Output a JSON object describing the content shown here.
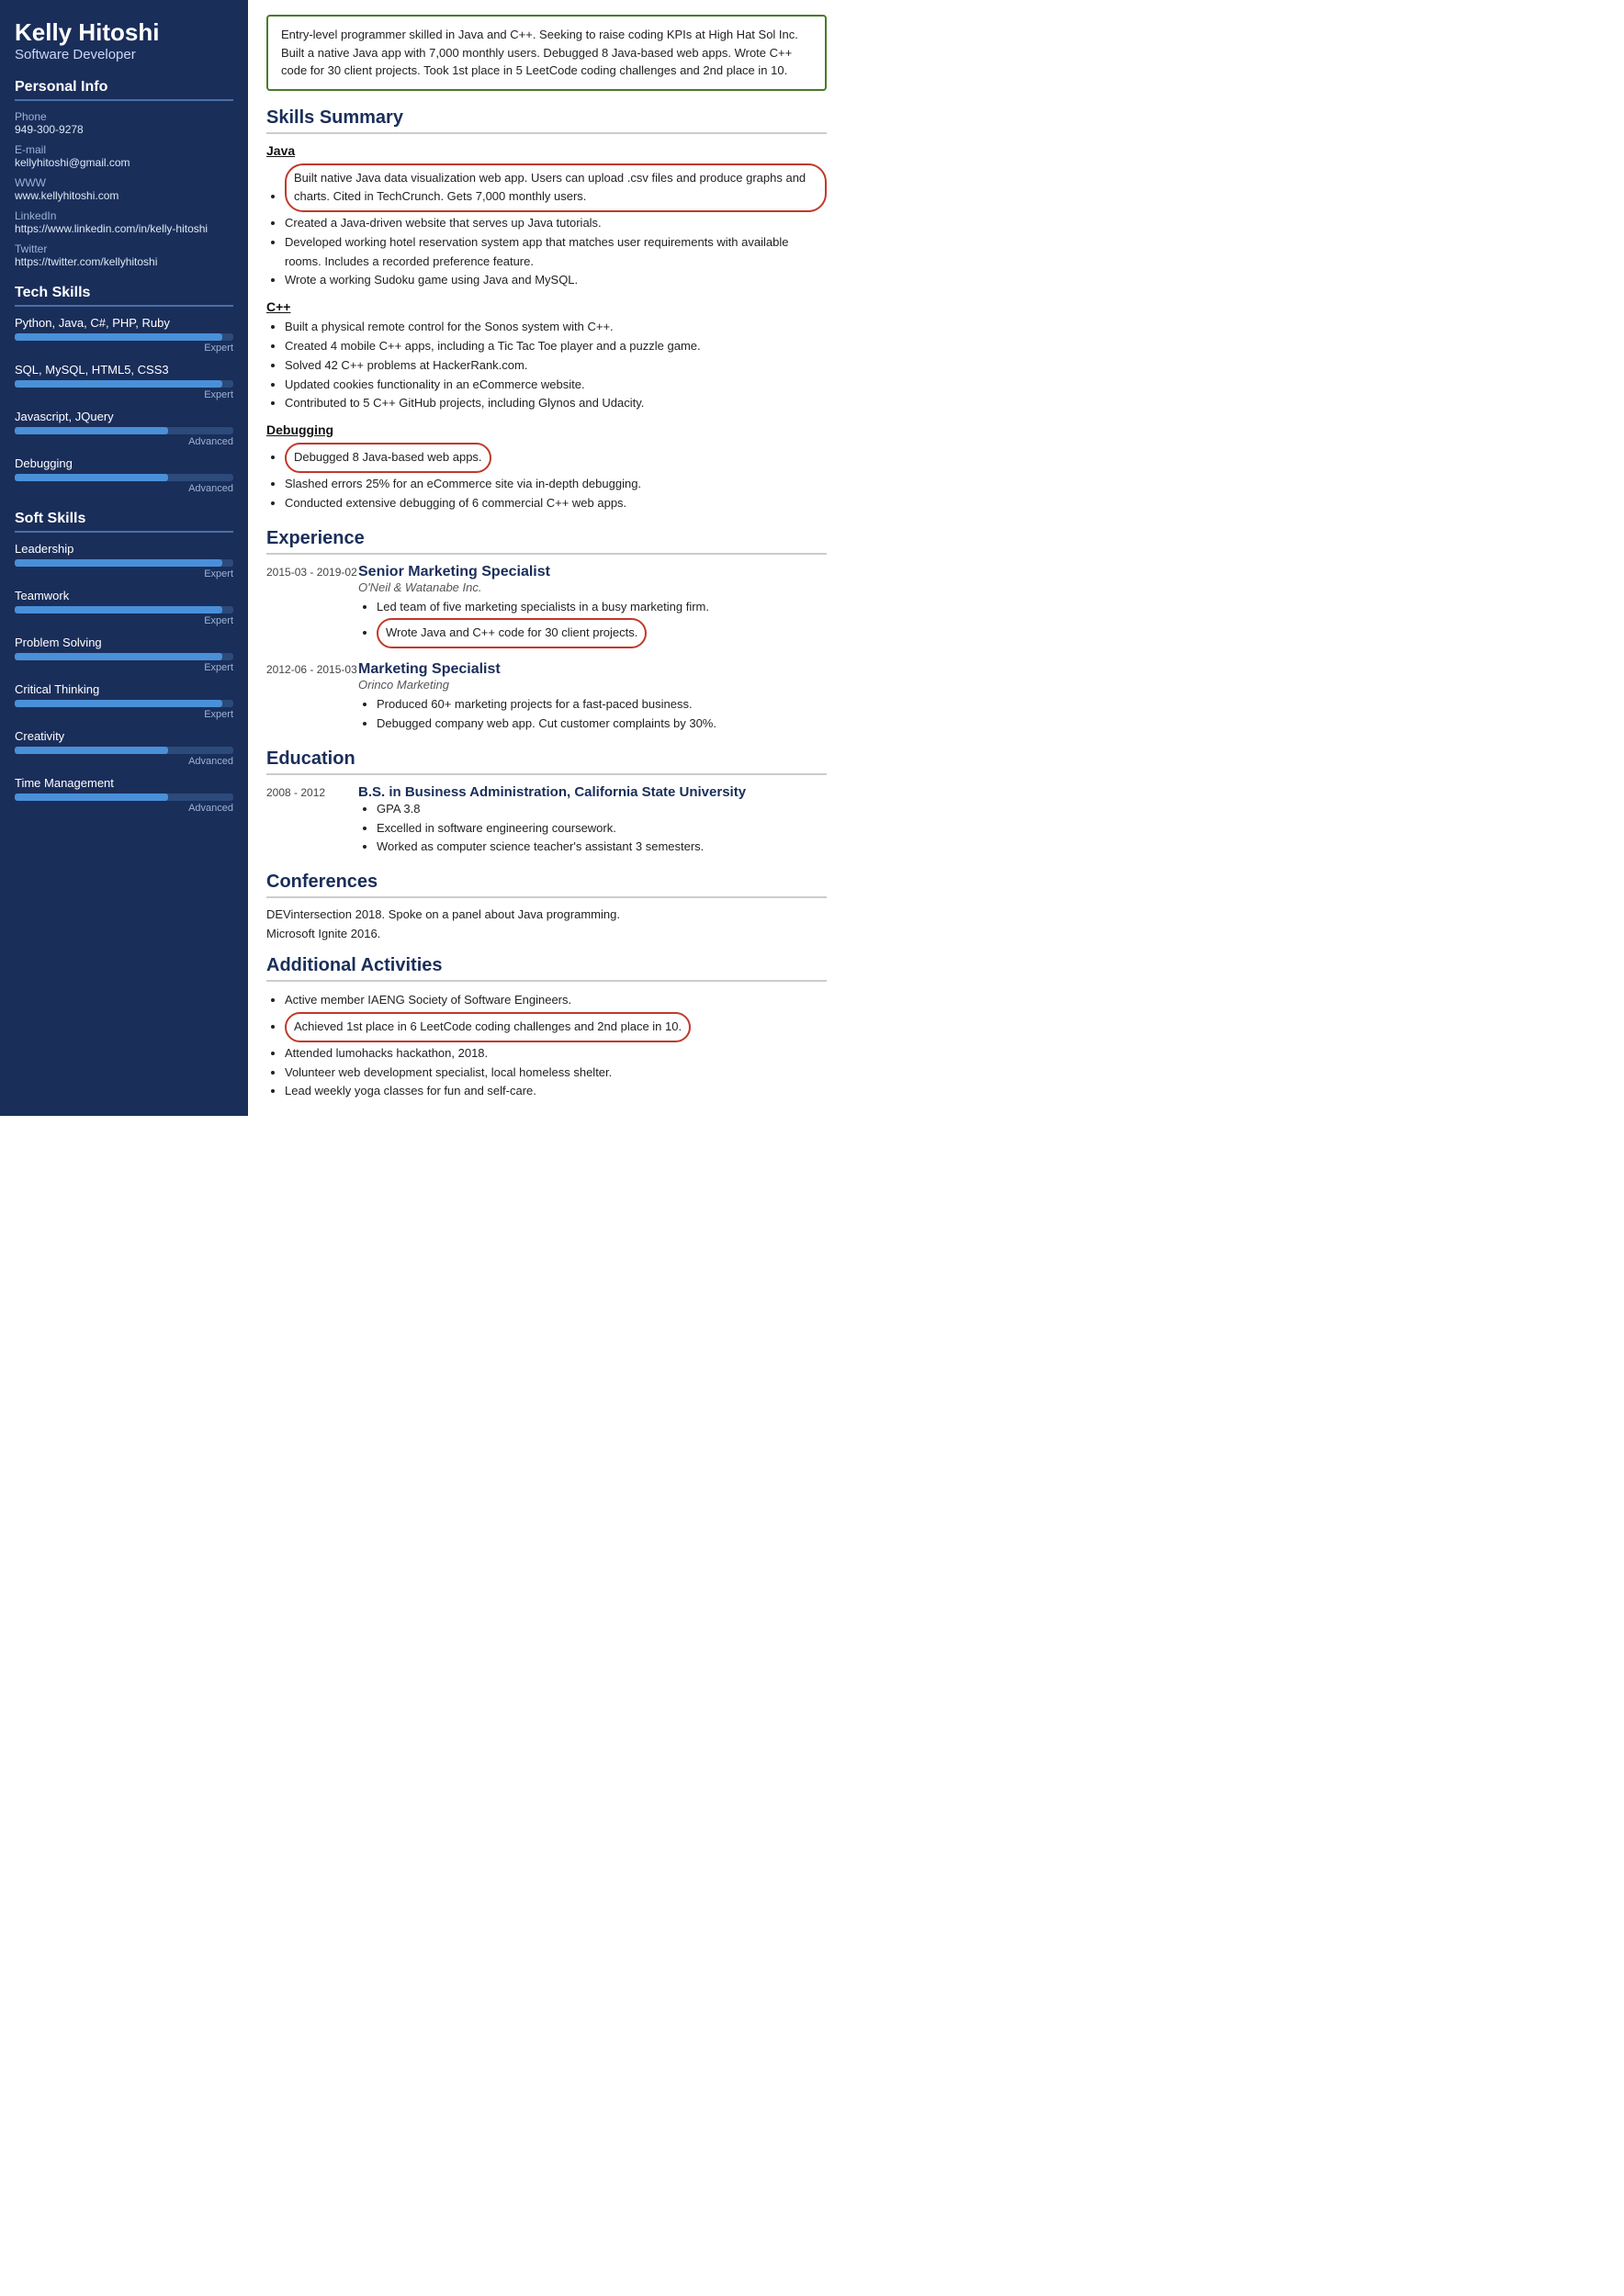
{
  "sidebar": {
    "name": "Kelly Hitoshi",
    "title": "Software Developer",
    "personalInfo": {
      "sectionTitle": "Personal Info",
      "phone": {
        "label": "Phone",
        "value": "949-300-9278"
      },
      "email": {
        "label": "E-mail",
        "value": "kellyhitoshi@gmail.com"
      },
      "www": {
        "label": "WWW",
        "value": "www.kellyhitoshi.com"
      },
      "linkedin": {
        "label": "LinkedIn",
        "value": "https://www.linkedin.com/in/kelly-hitoshi"
      },
      "twitter": {
        "label": "Twitter",
        "value": "https://twitter.com/kellyhitoshi"
      }
    },
    "techSkills": {
      "sectionTitle": "Tech Skills",
      "items": [
        {
          "name": "Python, Java, C#, PHP, Ruby",
          "pct": 95,
          "level": "Expert"
        },
        {
          "name": "SQL, MySQL, HTML5, CSS3",
          "pct": 95,
          "level": "Expert"
        },
        {
          "name": "Javascript, JQuery",
          "pct": 70,
          "level": "Advanced"
        },
        {
          "name": "Debugging",
          "pct": 70,
          "level": "Advanced"
        }
      ]
    },
    "softSkills": {
      "sectionTitle": "Soft Skills",
      "items": [
        {
          "name": "Leadership",
          "pct": 95,
          "level": "Expert"
        },
        {
          "name": "Teamwork",
          "pct": 95,
          "level": "Expert"
        },
        {
          "name": "Problem Solving",
          "pct": 95,
          "level": "Expert"
        },
        {
          "name": "Critical Thinking",
          "pct": 95,
          "level": "Expert"
        },
        {
          "name": "Creativity",
          "pct": 70,
          "level": "Advanced"
        },
        {
          "name": "Time Management",
          "pct": 70,
          "level": "Advanced"
        }
      ]
    }
  },
  "main": {
    "summary": "Entry-level programmer skilled in Java and C++. Seeking to raise coding KPIs at High Hat Sol Inc. Built a native Java app with 7,000 monthly users. Debugged 8 Java-based web apps. Wrote C++ code for 30 client projects. Took 1st place in 5 LeetCode coding challenges and 2nd place in 10.",
    "skillsSummary": {
      "title": "Skills Summary",
      "groups": [
        {
          "title": "Java",
          "bullets": [
            {
              "text": "Built native Java data visualization web app. Users can upload .csv files and produce graphs and charts. Cited in TechCrunch. Gets 7,000 monthly users.",
              "highlighted": true
            },
            {
              "text": "Created a Java-driven website that serves up Java tutorials.",
              "highlighted": false
            },
            {
              "text": "Developed working hotel reservation system app that matches user requirements with available rooms. Includes a recorded preference feature.",
              "highlighted": false
            },
            {
              "text": "Wrote a working Sudoku game using Java and MySQL.",
              "highlighted": false
            }
          ]
        },
        {
          "title": "C++",
          "bullets": [
            {
              "text": "Built a physical remote control for the Sonos system with C++.",
              "highlighted": false
            },
            {
              "text": "Created 4 mobile C++ apps, including a Tic Tac Toe player and a puzzle game.",
              "highlighted": false
            },
            {
              "text": "Solved 42 C++ problems at HackerRank.com.",
              "highlighted": false
            },
            {
              "text": "Updated cookies functionality in an eCommerce website.",
              "highlighted": false
            },
            {
              "text": "Contributed to 5 C++ GitHub projects, including Glynos and Udacity.",
              "highlighted": false
            }
          ]
        },
        {
          "title": "Debugging",
          "bullets": [
            {
              "text": "Debugged 8 Java-based web apps.",
              "highlighted": true
            },
            {
              "text": "Slashed errors 25% for an eCommerce site via in-depth debugging.",
              "highlighted": false
            },
            {
              "text": "Conducted extensive debugging of 6 commercial C++ web apps.",
              "highlighted": false
            }
          ]
        }
      ]
    },
    "experience": {
      "title": "Experience",
      "entries": [
        {
          "date": "2015-03 - 2019-02",
          "jobTitle": "Senior Marketing Specialist",
          "company": "O'Neil & Watanabe Inc.",
          "bullets": [
            {
              "text": "Led team of five marketing specialists in a busy marketing firm.",
              "highlighted": false
            },
            {
              "text": "Wrote Java and C++ code for 30 client projects.",
              "highlighted": true
            }
          ]
        },
        {
          "date": "2012-06 - 2015-03",
          "jobTitle": "Marketing Specialist",
          "company": "Orinco Marketing",
          "bullets": [
            {
              "text": "Produced 60+ marketing projects for a fast-paced business.",
              "highlighted": false
            },
            {
              "text": "Debugged company web app. Cut customer complaints by 30%.",
              "highlighted": false
            }
          ]
        }
      ]
    },
    "education": {
      "title": "Education",
      "entries": [
        {
          "date": "2008 - 2012",
          "degree": "B.S. in Business Administration, California State University",
          "bullets": [
            {
              "text": "GPA 3.8",
              "highlighted": false
            },
            {
              "text": "Excelled in software engineering coursework.",
              "highlighted": false
            },
            {
              "text": "Worked as computer science teacher's assistant 3 semesters.",
              "highlighted": false
            }
          ]
        }
      ]
    },
    "conferences": {
      "title": "Conferences",
      "items": [
        "DEVintersection 2018. Spoke on a panel about Java programming.",
        "Microsoft Ignite 2016."
      ]
    },
    "additionalActivities": {
      "title": "Additional Activities",
      "bullets": [
        {
          "text": "Active member IAENG Society of Software Engineers.",
          "highlighted": false
        },
        {
          "text": "Achieved 1st place in 6 LeetCode coding challenges and 2nd place in 10.",
          "highlighted": true
        },
        {
          "text": "Attended lumohacks hackathon, 2018.",
          "highlighted": false
        },
        {
          "text": "Volunteer web development specialist, local homeless shelter.",
          "highlighted": false
        },
        {
          "text": "Lead weekly yoga classes for fun and self-care.",
          "highlighted": false
        }
      ]
    }
  }
}
